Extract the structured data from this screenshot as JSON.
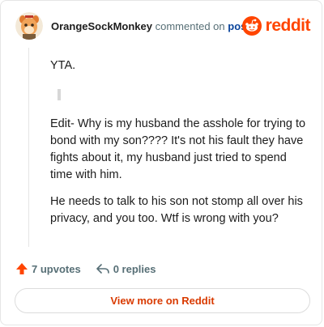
{
  "comment": {
    "username": "OrangeSockMonkey",
    "action_text": "commented on",
    "post_link": "post",
    "paragraphs": [
      "YTA.",
      "Edit- Why is my husband the asshole for trying to bond with my son???? It's not his fault they have fights about it, my husband just tried to spend time with him.",
      "He needs to talk to his son not stomp all over his privacy, and you too. Wtf is wrong with you?"
    ]
  },
  "brand": {
    "name": "reddit",
    "color": "#ff4500",
    "icon": "reddit-logo-icon"
  },
  "actions": {
    "upvotes_label": "7 upvotes",
    "upvote_icon": "upvote-arrow-icon",
    "upvote_color": "#ff4500",
    "replies_label": "0 replies",
    "reply_icon": "reply-arrow-icon"
  },
  "footer": {
    "view_more_label": "View more on Reddit",
    "view_more_color": "#d93a00"
  }
}
